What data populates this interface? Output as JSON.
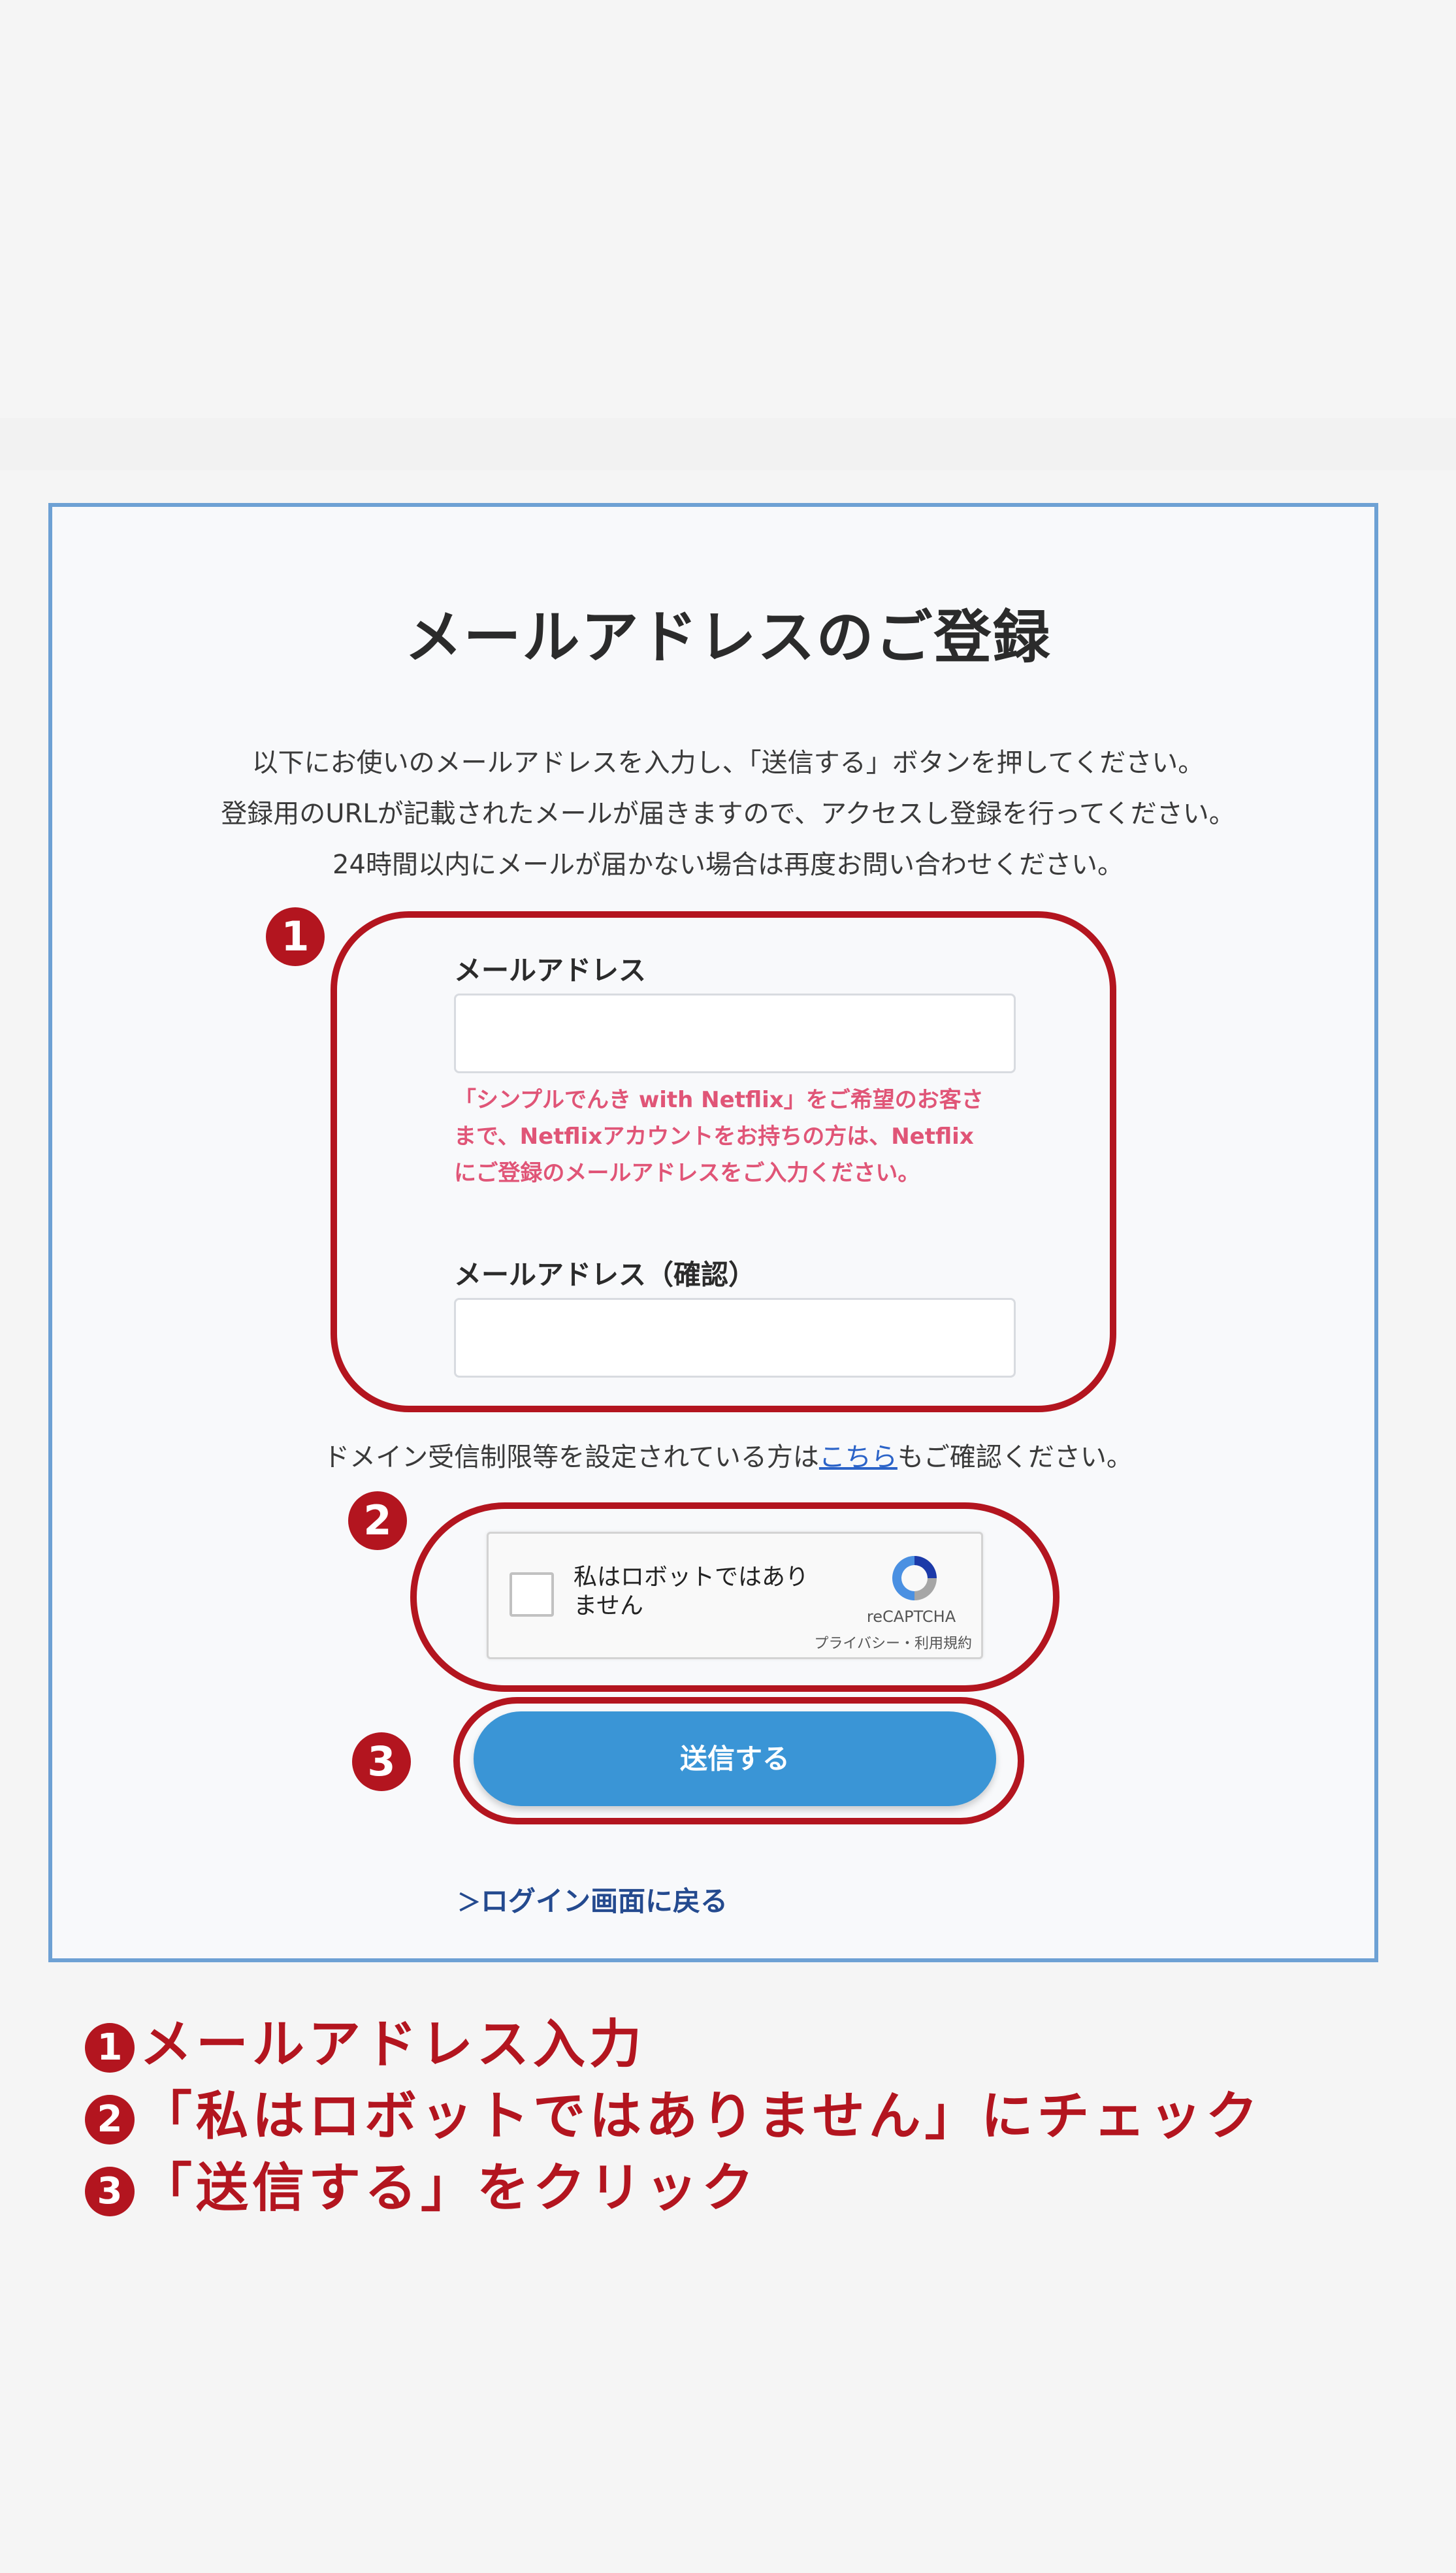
{
  "form": {
    "title": "メールアドレスのご登録",
    "description": [
      "以下にお使いのメールアドレスを入力し、「送信する」ボタンを押してください。",
      "登録用のURLが記載されたメールが届きますので、アクセスし登録を行ってください。",
      "24時間以内にメールが届かない場合は再度お問い合わせください。"
    ],
    "email_label": "メールアドレス",
    "email_value": "",
    "netflix_note": [
      "「シンプルでんき with Netflix」をご希望のお客さ",
      "まで、Netflixアカウントをお持ちの方は、Netflix",
      "にご登録のメールアドレスをご入力ください。"
    ],
    "email_confirm_label": "メールアドレス（確認）",
    "email_confirm_value": "",
    "domain_notice_prefix": "ドメイン受信制限等を設定されている方は",
    "domain_notice_link": "こちら",
    "domain_notice_suffix": "もご確認ください。",
    "recaptcha": {
      "label_line1": "私はロボットではあり",
      "label_line2": "ません",
      "brand": "reCAPTCHA",
      "privacy": "プライバシー",
      "separator": "・",
      "terms": "利用規約"
    },
    "submit_label": "送信する",
    "back_chevron": "＞",
    "back_label": "ログイン画面に戻る"
  },
  "annotations": {
    "marker1": "1",
    "marker2": "2",
    "marker3": "3",
    "steps": [
      {
        "num": "1",
        "text": "メールアドレス入力"
      },
      {
        "num": "2",
        "text": "「私はロボットではありません」にチェック"
      },
      {
        "num": "3",
        "text": "「送信する」をクリック"
      }
    ]
  },
  "colors": {
    "accent_red": "#b3151f",
    "button_blue": "#3a95d6",
    "card_border": "#6ea1d4",
    "note_pink": "#e05577",
    "link_blue": "#2b63c8"
  }
}
